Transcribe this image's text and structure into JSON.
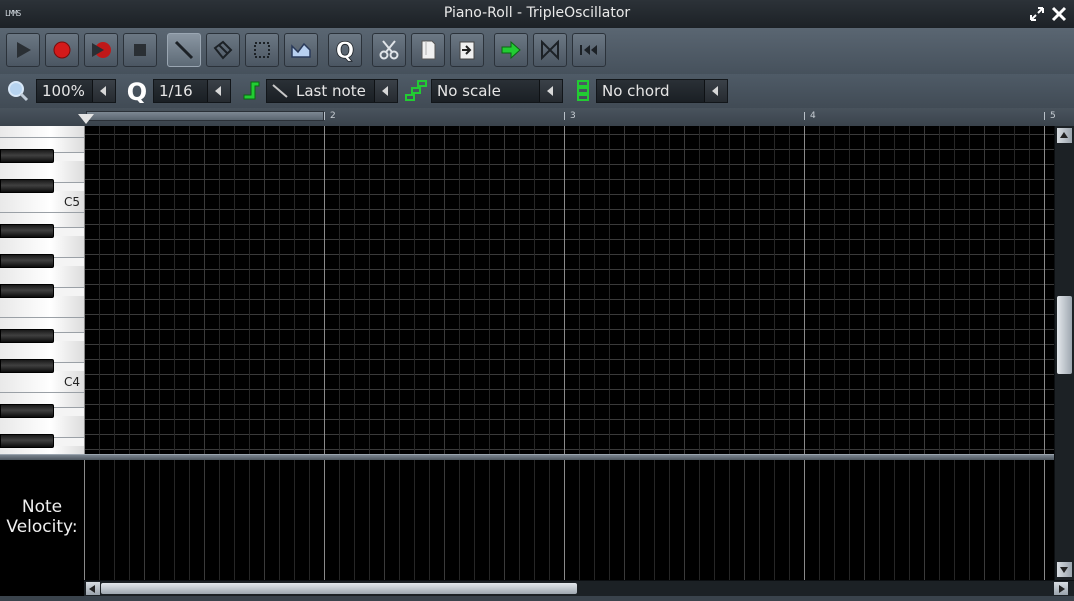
{
  "window": {
    "app_tag": "LMMS",
    "title": "Piano-Roll - TripleOscillator"
  },
  "toolbar": {
    "buttons": [
      {
        "name": "play-button",
        "icon": "play-icon"
      },
      {
        "name": "record-button",
        "icon": "record-icon"
      },
      {
        "name": "record-while-playing-button",
        "icon": "record-play-icon"
      },
      {
        "name": "stop-button",
        "icon": "stop-icon"
      },
      {
        "name": "draw-mode-button",
        "icon": "pencil-icon",
        "active": true
      },
      {
        "name": "erase-mode-button",
        "icon": "eraser-icon"
      },
      {
        "name": "select-mode-button",
        "icon": "selection-icon"
      },
      {
        "name": "detune-mode-button",
        "icon": "automation-icon"
      },
      {
        "name": "quantize-button",
        "icon": "quantize-icon"
      },
      {
        "name": "cut-button",
        "icon": "scissors-icon"
      },
      {
        "name": "copy-button",
        "icon": "copy-icon"
      },
      {
        "name": "paste-button",
        "icon": "paste-icon"
      },
      {
        "name": "stop-behaviour-return-button",
        "icon": "arrow-right-icon"
      },
      {
        "name": "stop-behaviour-keep-button",
        "icon": "bowtie-icon"
      },
      {
        "name": "stop-behaviour-start-button",
        "icon": "skip-back-icon"
      }
    ]
  },
  "controls": {
    "zoom": {
      "value": "100%"
    },
    "quantize": {
      "value": "1/16"
    },
    "note_length": {
      "value": "Last note"
    },
    "scale": {
      "value": "No scale"
    },
    "chord": {
      "value": "No chord"
    }
  },
  "timeline": {
    "bars": [
      "2",
      "3",
      "4",
      "5"
    ]
  },
  "keyboard": {
    "labels": [
      "C5",
      "C4"
    ]
  },
  "velocity": {
    "label_line1": "Note",
    "label_line2": "Velocity:"
  },
  "colors": {
    "grid_background": "#000000",
    "grid_minor": "#1e1e1e",
    "grid_beat": "#3a3a3a",
    "grid_bar": "#8a8a8a",
    "accent_green": "#22cc33",
    "record_red": "#d41a1a"
  }
}
